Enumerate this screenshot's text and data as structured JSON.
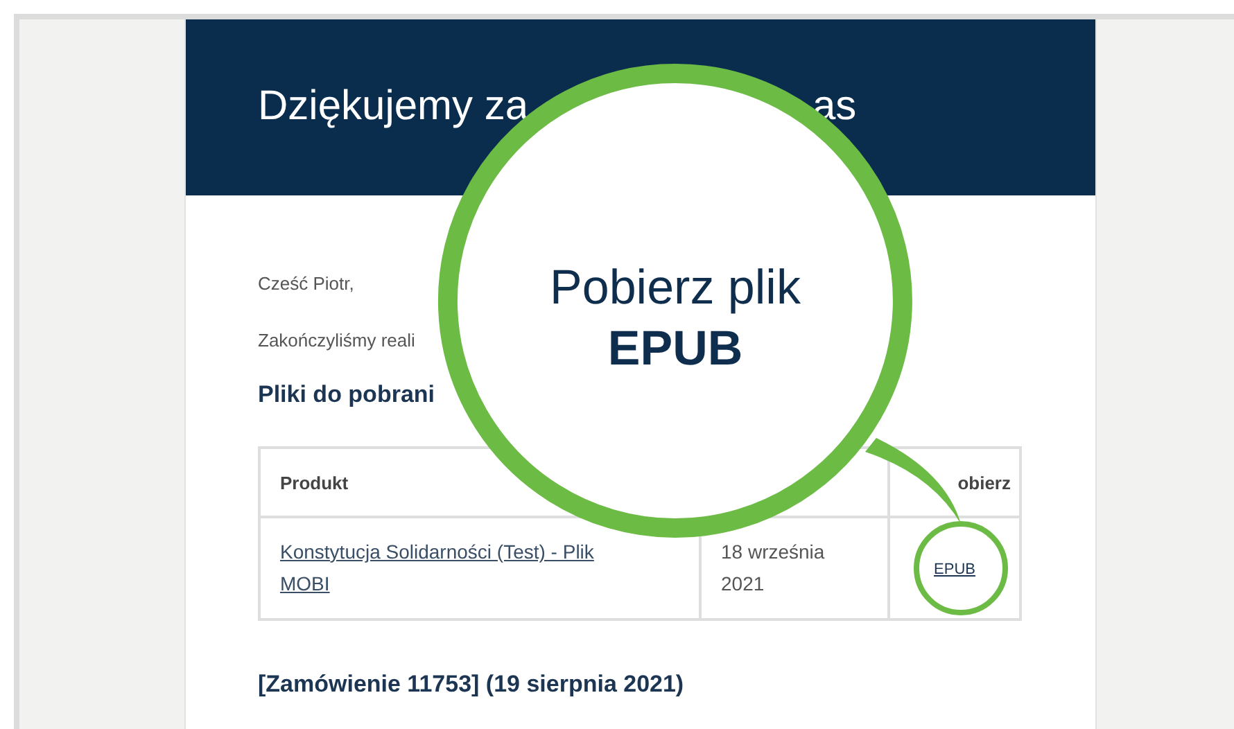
{
  "email": {
    "header": {
      "title_fragments": [
        "Dziękujemy za",
        "as"
      ]
    },
    "greeting": "Cześć Piotr,",
    "intro": "Zakończyliśmy reali",
    "downloads_heading": "Pliki do pobrani",
    "table": {
      "columns": [
        "Produkt",
        "",
        "obierz"
      ],
      "rows": [
        {
          "product": "Konstytucja Solidarności (Test) - Plik MOBI",
          "date": "18 września 2021",
          "download": "EPUB"
        }
      ]
    },
    "order_heading": "[Zamówienie 11753] (19 sierpnia 2021)"
  },
  "callout": {
    "line_1": "Pobierz plik",
    "line_2": "EPUB"
  }
}
